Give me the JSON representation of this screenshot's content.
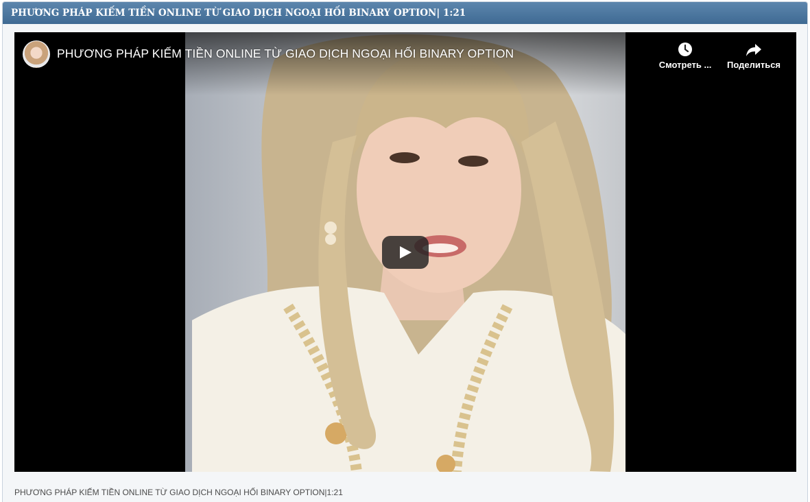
{
  "header": {
    "title": "PHƯƠNG PHÁP KIẾM TIỀN ONLINE TỪ GIAO DỊCH NGOẠI HỐI BINARY OPTION| 1:21"
  },
  "video": {
    "title": "PHƯƠNG PHÁP KIẾM TIỀN ONLINE TỪ GIAO DỊCH NGOẠI HỐI BINARY OPTION",
    "watch_later_label": "Смотреть ...",
    "share_label": "Поделиться",
    "icons": {
      "watch_later": "clock-icon",
      "share": "share-arrow-icon",
      "play": "play-icon",
      "avatar": "channel-avatar"
    },
    "colors": {
      "background": "#000000",
      "play_button": "#212121"
    }
  },
  "caption": {
    "text": "PHƯƠNG PHÁP KIẾM TIỀN ONLINE TỪ GIAO DỊCH NGOẠI HỐI BINARY OPTION|1:21"
  },
  "theme": {
    "header_bg": "#4a7499",
    "panel_bg": "#f4f6f8"
  }
}
